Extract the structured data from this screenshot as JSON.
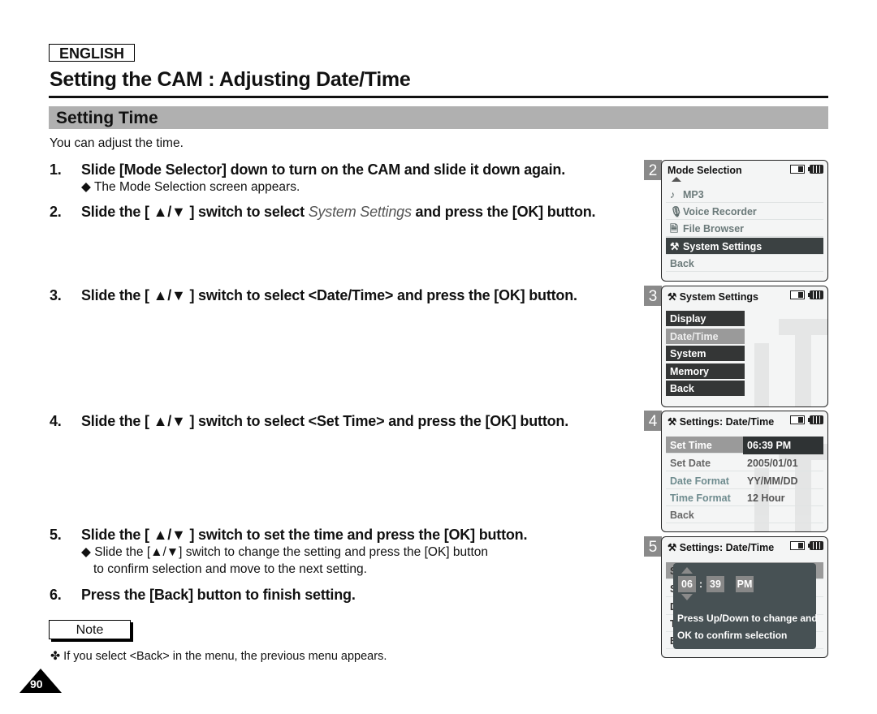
{
  "header": {
    "language": "ENGLISH",
    "title": "Setting the CAM : Adjusting Date/Time",
    "section": "Setting Time",
    "intro": "You can adjust the time."
  },
  "steps": [
    {
      "num": "1.",
      "text": "Slide [Mode Selector] down to turn on the CAM and slide it down again.",
      "sub": [
        "◆ The Mode Selection screen appears."
      ]
    },
    {
      "num": "2.",
      "pre": "Slide the [ ▲/▼ ] switch to select ",
      "em": "System Settings",
      "post": " and press the [OK] button."
    },
    {
      "num": "3.",
      "text": "Slide the [ ▲/▼ ] switch to select <Date/Time> and press the [OK] button."
    },
    {
      "num": "4.",
      "text": "Slide the [ ▲/▼ ] switch to select <Set Time> and press the [OK] button."
    },
    {
      "num": "5.",
      "text": "Slide the [ ▲/▼ ] switch to set the time and press the [OK] button.",
      "sub": [
        "◆ Slide the [▲/▼] switch to change the setting and press the [OK] button",
        "to confirm selection and move to the next setting."
      ]
    },
    {
      "num": "6.",
      "text": "Press the [Back] button to finish setting."
    }
  ],
  "note": {
    "label": "Note",
    "text": "✤   If you select <Back> in the menu, the previous menu appears."
  },
  "page_number": "90",
  "screens": {
    "s2": {
      "badge": "2",
      "title": "Mode Selection",
      "items": [
        {
          "icon": "♪",
          "label": "MP3"
        },
        {
          "icon": "🎙",
          "label": "Voice Recorder"
        },
        {
          "icon": "🗎",
          "label": "File Browser"
        },
        {
          "icon": "⚒",
          "label": "System Settings",
          "selected": true
        },
        {
          "icon": "",
          "label": "Back"
        }
      ]
    },
    "s3": {
      "badge": "3",
      "title": "System Settings",
      "items": [
        "Display",
        "Date/Time",
        "System",
        "Memory",
        "Back"
      ],
      "selected": "Date/Time"
    },
    "s4": {
      "badge": "4",
      "title": "Settings: Date/Time",
      "rows": [
        {
          "label": "Set Time",
          "value": "06:39 PM",
          "selected": true
        },
        {
          "label": "Set Date",
          "value": "2005/01/01"
        },
        {
          "label": "Date Format",
          "value": "YY/MM/DD"
        },
        {
          "label": "Time Format",
          "value": "12 Hour"
        },
        {
          "label": "Back",
          "value": ""
        }
      ]
    },
    "s5": {
      "badge": "5",
      "title": "Settings: Date/Time",
      "row_initials": [
        "S",
        "S",
        "D",
        "T",
        "B"
      ],
      "hour": "06",
      "separator": ":",
      "minute": "39",
      "ampm": "PM",
      "message_line1": "Press Up/Down to change and",
      "message_line2": "OK to confirm selection"
    }
  }
}
